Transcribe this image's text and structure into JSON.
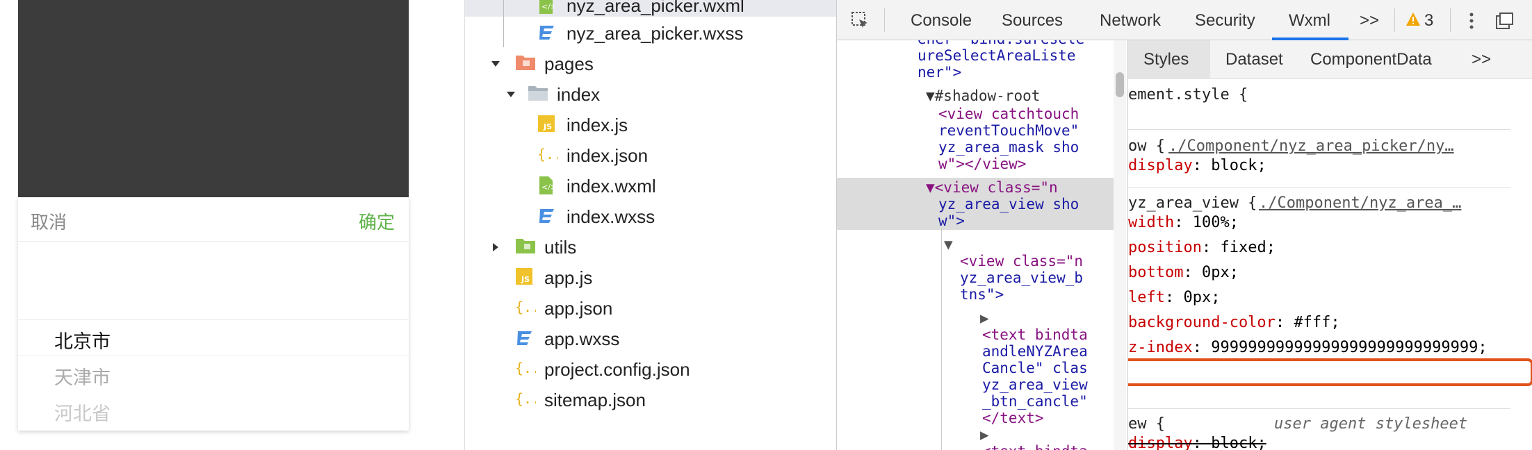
{
  "simulator": {
    "cancel_label": "取消",
    "confirm_label": "确定",
    "options": [
      "北京市",
      "天津市",
      "河北省"
    ]
  },
  "file_tree": {
    "items": [
      {
        "label": "nyz_area_picker.wxml",
        "icon": "wxml-file-icon"
      },
      {
        "label": "nyz_area_picker.wxss",
        "icon": "wxss-file-icon"
      },
      {
        "label": "pages",
        "icon": "folder-icon"
      },
      {
        "label": "index",
        "icon": "folder-open-icon"
      },
      {
        "label": "index.js",
        "icon": "js-file-icon"
      },
      {
        "label": "index.json",
        "icon": "json-file-icon"
      },
      {
        "label": "index.wxml",
        "icon": "wxml-file-icon"
      },
      {
        "label": "index.wxss",
        "icon": "wxss-file-icon"
      },
      {
        "label": "utils",
        "icon": "folder-icon"
      },
      {
        "label": "app.js",
        "icon": "js-file-icon"
      },
      {
        "label": "app.json",
        "icon": "json-file-icon"
      },
      {
        "label": "app.wxss",
        "icon": "wxss-file-icon"
      },
      {
        "label": "project.config.json",
        "icon": "json-file-icon"
      },
      {
        "label": "sitemap.json",
        "icon": "json-file-icon"
      }
    ]
  },
  "devtools": {
    "tabs": [
      "Console",
      "Sources",
      "Network",
      "Security",
      "Wxml"
    ],
    "active_tab": "Wxml",
    "more_tabs": ">>",
    "warning_count": "3",
    "style_tabs": [
      "Styles",
      "Dataset",
      "ComponentData"
    ],
    "style_more": ">>",
    "elements": {
      "l1": "ener\" bind:suresele",
      "l2": "ureSelectAreaListe",
      "l3": "ner\">",
      "shadow_root": "#shadow-root",
      "view1_tag": "<view catchtouch",
      "view1_l2": "reventTouchMove\"",
      "view1_l3": "yz_area_mask sho",
      "view1_l4": "w\"></view>",
      "view2_l1": "<view class=\"n",
      "view2_l2": "yz_area_view sho",
      "view2_l3": "w\">",
      "view3_l1": "<view class=\"n",
      "view3_l2": "yz_area_view_b",
      "view3_l3": "tns\">",
      "text1_l1": "<text bindta",
      "text1_l2": "andleNYZArea",
      "text1_l3": "Cancle\" clas",
      "text1_l4": "yz_area_view",
      "text1_l5": "_btn_cancle\"",
      "text1_l6": "</text>",
      "text2_l1": "<text bindta"
    },
    "styles": {
      "element_style": "ement.style {",
      "rule1_selector": "ow {",
      "rule1_source": "./Component/nyz_area_picker/ny…",
      "rule1_prop": "display",
      "rule1_val": "block;",
      "rule2_selector": "yz_area_view {",
      "rule2_source": "./Component/nyz_area_…",
      "props": [
        {
          "name": "width",
          "value": "100%;"
        },
        {
          "name": "position",
          "value": "fixed;"
        },
        {
          "name": "bottom",
          "value": "0px;"
        },
        {
          "name": "left",
          "value": "0px;"
        },
        {
          "name": "background-color",
          "value": "#fff;"
        },
        {
          "name": "z-index",
          "value": "99999999999999999999999999999;"
        }
      ],
      "ua_selector": "ew {",
      "ua_label": "user agent stylesheet",
      "ua_prop": "display",
      "ua_val": "block;"
    }
  },
  "colors": {
    "highlight": "#e0531c",
    "confirm": "#5fb24a",
    "active_tab": "#1a73e8"
  }
}
